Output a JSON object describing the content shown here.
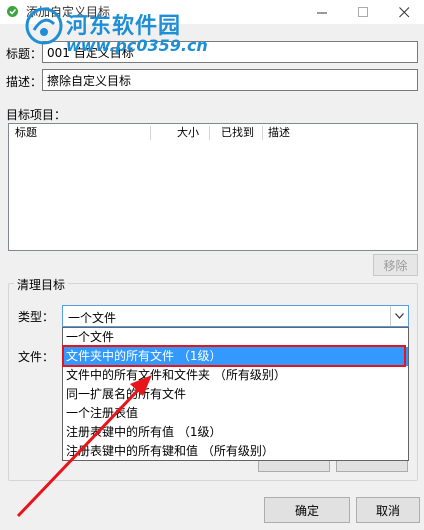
{
  "window": {
    "title": "添加自定义目标",
    "minimize_icon": "minimize-icon",
    "maximize_icon": "maximize-icon",
    "close_icon": "close-icon"
  },
  "watermark": {
    "brand": "河东软件园",
    "url": "www.pc0359.cn"
  },
  "form": {
    "title_label": "标题：",
    "title_value": "001 自定义目标",
    "desc_label": "描述：",
    "desc_value": "擦除自定义目标"
  },
  "targets": {
    "section_label": "目标项目：",
    "columns": [
      "标题",
      "大小",
      "已找到",
      "描述"
    ],
    "remove_button": "移除"
  },
  "cleanup": {
    "group_title": "清理目标",
    "type_label": "类型：",
    "type_value": "一个文件",
    "file_label": "文件：",
    "options": [
      "一个文件",
      "文件夹中的所有文件 （1级）",
      "文件中的所有文件和文件夹 （所有级别）",
      "同一扩展名的所有文件",
      "一个注册表值",
      "注册表键中的所有值 （1级）",
      "注册表键中的所有键和值 （所有级别）"
    ],
    "selected_index": 1
  },
  "buttons": {
    "ok": "确定",
    "cancel": "取消"
  },
  "colors": {
    "selection": "#3399ff",
    "highlight_box": "#e8141a",
    "arrow": "#e8141a",
    "watermark": "#1e8fd6"
  }
}
